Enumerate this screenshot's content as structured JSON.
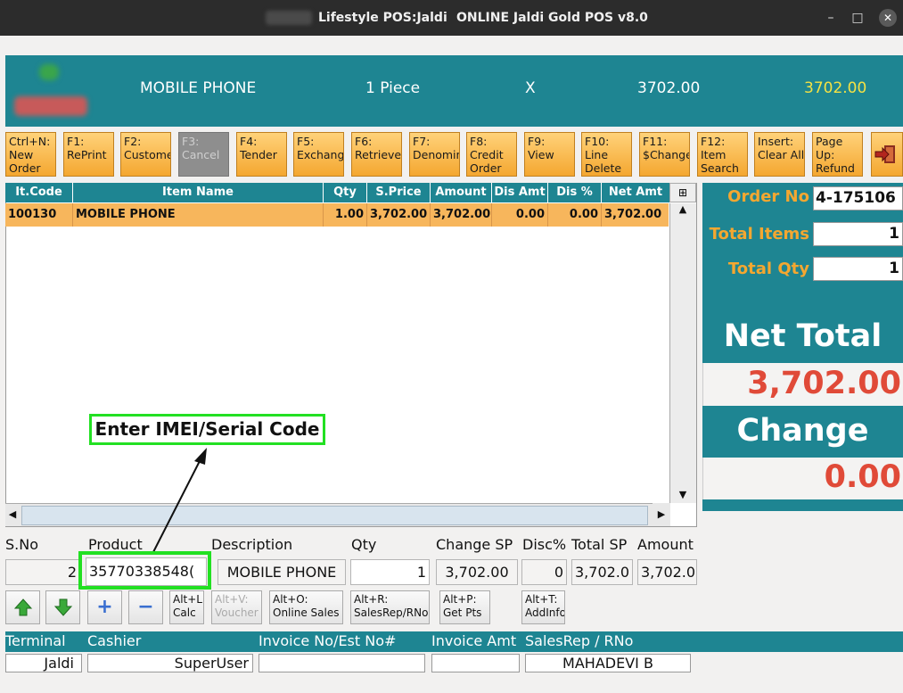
{
  "window": {
    "app_title": "Lifestyle POS:Jaldi",
    "version_title": "ONLINE Jaldi Gold POS v8.0",
    "minimize": "–",
    "maximize": "□",
    "close": "✕"
  },
  "header": {
    "item_name": "MOBILE PHONE",
    "quantity": "1 Piece",
    "multiply": "X",
    "price": "3702.00",
    "total": "3702.00"
  },
  "toolbar": [
    {
      "key": "new_order",
      "label": "Ctrl+N:\nNew\nOrder"
    },
    {
      "key": "reprint",
      "label": "F1:\nRePrint"
    },
    {
      "key": "customer",
      "label": "F2:\nCustome"
    },
    {
      "key": "cancel",
      "label": "F3:\nCancel"
    },
    {
      "key": "tender",
      "label": "F4:\nTender"
    },
    {
      "key": "exchange",
      "label": "F5:\nExchang"
    },
    {
      "key": "retrieve",
      "label": "F6:\nRetrieve"
    },
    {
      "key": "denomination",
      "label": "F7:\nDenomin"
    },
    {
      "key": "credit_order",
      "label": "F8:\nCredit\nOrder"
    },
    {
      "key": "view",
      "label": "F9:\nView"
    },
    {
      "key": "line_delete",
      "label": "F10:\nLine\nDelete"
    },
    {
      "key": "change",
      "label": "F11:\n$Change"
    },
    {
      "key": "item_search",
      "label": "F12:\nItem\nSearch"
    },
    {
      "key": "clear_all",
      "label": "Insert:\nClear All"
    },
    {
      "key": "refund",
      "label": "Page\nUp:\nRefund"
    }
  ],
  "grid": {
    "columns": [
      "It.Code",
      "Item Name",
      "Qty",
      "S.Price",
      "Amount",
      "Dis Amt",
      "Dis %",
      "Net Amt"
    ],
    "rows": [
      [
        "100130",
        "MOBILE PHONE",
        "1.00",
        "3,702.00",
        "3,702.00",
        "0.00",
        "0.00",
        "3,702.00"
      ]
    ]
  },
  "summary": {
    "order_no_label": "Order No",
    "order_no": "4-175106",
    "total_items_label": "Total Items",
    "total_items": "1",
    "total_qty_label": "Total Qty",
    "total_qty": "1",
    "net_total_label": "Net Total",
    "net_total": "3,702.00",
    "change_label": "Change",
    "change": "0.00"
  },
  "entry": {
    "labels": {
      "sno": "S.No",
      "product": "Product",
      "description": "Description",
      "qty": "Qty",
      "change_sp": "Change SP",
      "disc": "Disc%",
      "total_sp": "Total SP",
      "amount": "Amount"
    },
    "sno": "2",
    "product": "35770338548(",
    "description": "MOBILE PHONE",
    "qty": "1",
    "change_sp": "3,702.00",
    "disc": "0",
    "total_sp": "3,702.0",
    "amount": "3,702.0"
  },
  "actions": [
    {
      "key": "calc",
      "label": "Alt+L:\nCalc"
    },
    {
      "key": "voucher",
      "label": "Alt+V:\nVoucher"
    },
    {
      "key": "online_sales",
      "label": "Alt+O:\nOnline Sales"
    },
    {
      "key": "salesrep",
      "label": "Alt+R:\nSalesRep/RNo"
    },
    {
      "key": "get_pts",
      "label": "Alt+P:\nGet Pts"
    },
    {
      "key": "addinfo",
      "label": "Alt+T:\nAddInfo"
    }
  ],
  "footer": {
    "terminal_label": "Terminal",
    "terminal": "Jaldi",
    "cashier_label": "Cashier",
    "cashier": "SuperUser",
    "invoice_no_label": "Invoice No/Est No#",
    "invoice_no": "",
    "invoice_amt_label": "Invoice Amt",
    "invoice_amt": "",
    "salesrep_label": "SalesRep / RNo",
    "salesrep": "MAHADEVI B"
  },
  "annotation": {
    "callout_text": "Enter IMEI/Serial Code"
  },
  "colors": {
    "teal": "#1e8592",
    "orange_button": "#f4a730",
    "selected_row": "#f7b65c",
    "amount_red": "#e04a38",
    "highlight_green": "#22e022"
  }
}
